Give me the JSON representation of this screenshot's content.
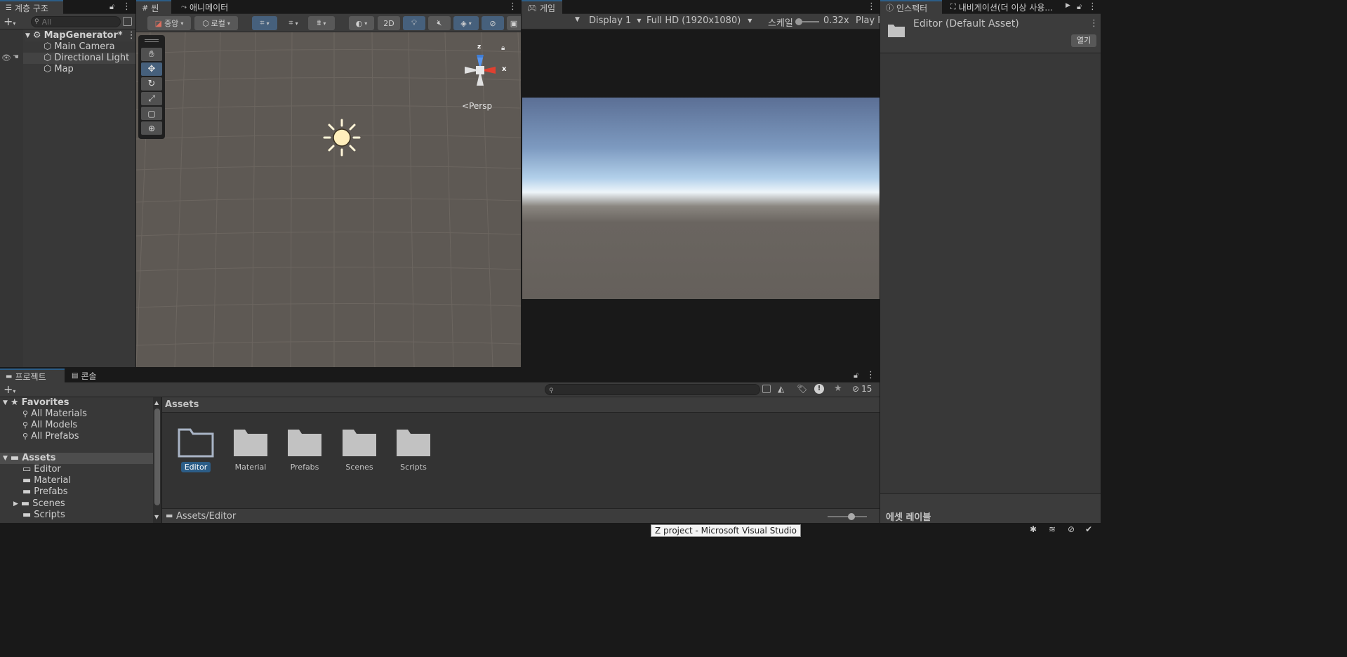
{
  "hierarchy": {
    "tab": "계층 구조",
    "search_placeholder": "All",
    "scene_name": "MapGenerator*",
    "items": [
      "Main Camera",
      "Directional Light",
      "Map"
    ]
  },
  "scene_view": {
    "tabs": [
      "씬",
      "애니메이터"
    ],
    "pivot_label": "중앙",
    "space_label": "로컬",
    "mode_2d": "2D",
    "persp_label": "Persp",
    "gizmo_axes": {
      "z": "z",
      "x": "x"
    }
  },
  "game_view": {
    "tab": "게임",
    "display": "Display 1",
    "resolution": "Full HD (1920x1080)",
    "scale_label": "스케일",
    "scale_value": "0.32x",
    "play_label": "Play F"
  },
  "inspector": {
    "tabs": [
      "인스펙터",
      "내비게이션(더 이상 사용..."
    ],
    "title": "Editor (Default Asset)",
    "open_button": "열기",
    "asset_labels": "에셋 레이블"
  },
  "project": {
    "tabs": [
      "프로젝트",
      "콘솔"
    ],
    "hidden_count": "15",
    "favorites_label": "Favorites",
    "favorites": [
      "All Materials",
      "All Models",
      "All Prefabs"
    ],
    "assets_label": "Assets",
    "asset_tree": [
      "Editor",
      "Material",
      "Prefabs",
      "Scenes",
      "Scripts"
    ],
    "grid_header": "Assets",
    "grid_items": [
      "Editor",
      "Material",
      "Prefabs",
      "Scenes",
      "Scripts"
    ],
    "selected_item": "Editor",
    "path": "Assets/Editor"
  },
  "status_bar": {
    "tooltip": "Z project - Microsoft Visual Studio"
  },
  "colors": {
    "accent_blue": "#2c5d87",
    "selection": "#2c5d87",
    "scene_bg": "#5e5954",
    "sky_top": "#5a7299",
    "ground": "#64605c"
  }
}
